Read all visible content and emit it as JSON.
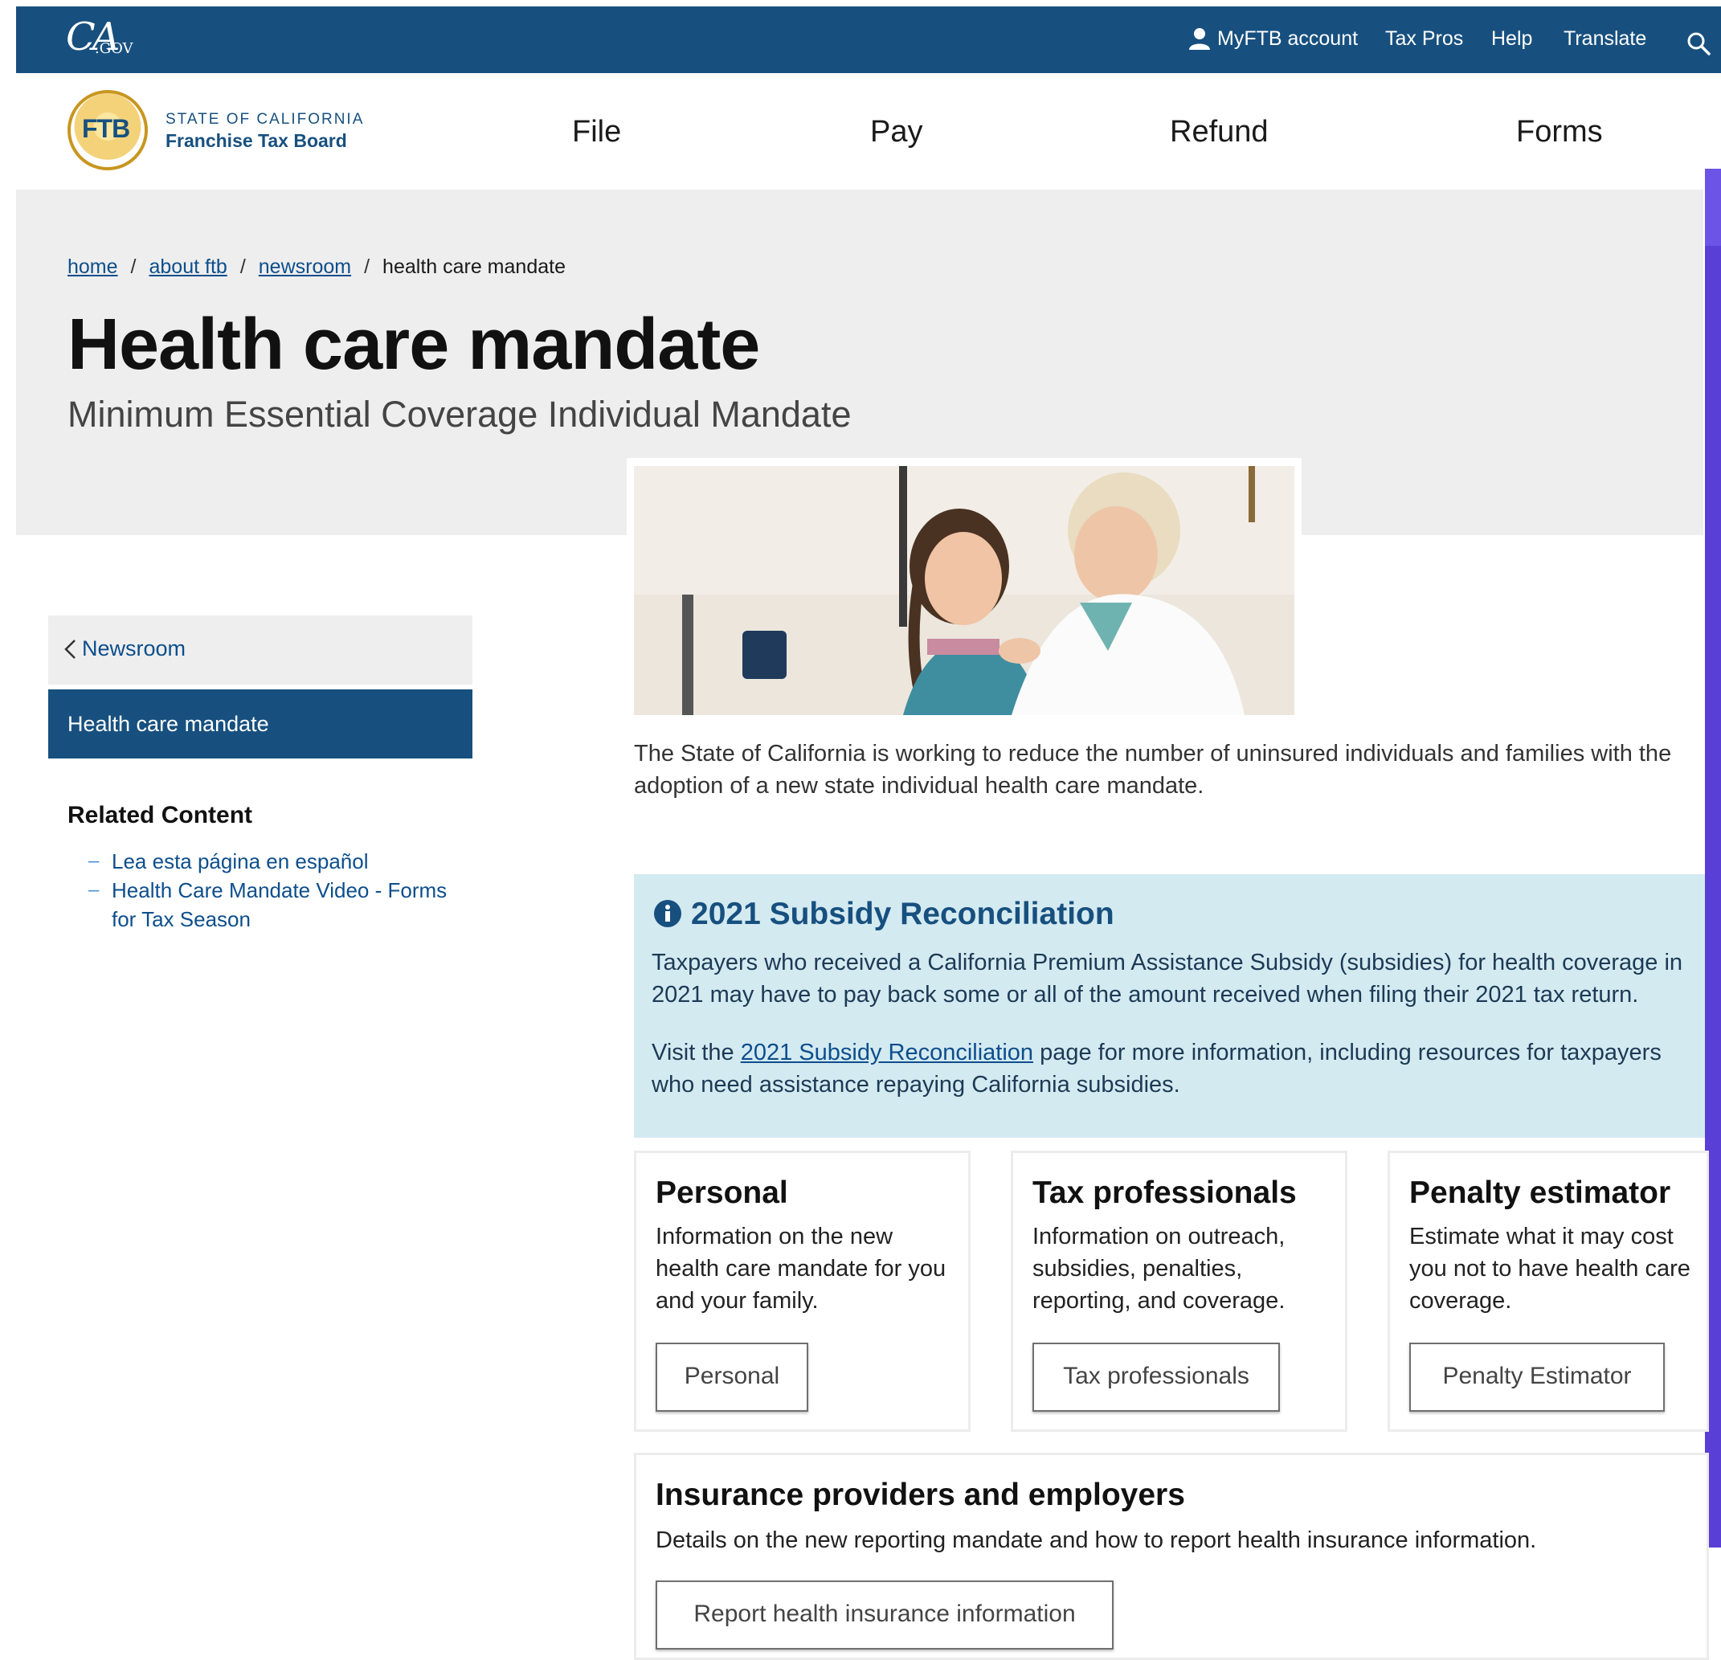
{
  "topbar": {
    "myftb_label": "MyFTB account",
    "taxpros_label": "Tax Pros",
    "help_label": "Help",
    "translate_label": "Translate",
    "brand_color": "#17507f"
  },
  "header": {
    "logo_text": "FTB",
    "state_text": "STATE OF CALIFORNIA",
    "agency_text": "Franchise Tax Board",
    "nav": [
      "File",
      "Pay",
      "Refund",
      "Forms"
    ]
  },
  "breadcrumb": {
    "home": "home",
    "about": "about ftb",
    "newsroom": "newsroom",
    "current": "health care mandate"
  },
  "page": {
    "title": "Health care mandate",
    "subtitle": "Minimum Essential Coverage Individual Mandate",
    "intro": "The State of California is working to reduce the number of uninsured individuals and families with the adoption of a new state individual health care mandate."
  },
  "sidebar": {
    "back_label": "Newsroom",
    "active_label": "Health care mandate",
    "related_title": "Related Content",
    "related": [
      "Lea esta página en español",
      "Health Care Mandate Video - Forms for Tax Season"
    ]
  },
  "alert": {
    "title": "2021 Subsidy Reconciliation",
    "p1": "Taxpayers who received a California Premium Assistance Subsidy (subsidies) for health coverage in 2021 may have to pay back some or all of the amount received when filing their 2021 tax return.",
    "p2_prefix": "Visit the ",
    "p2_link": "2021 Subsidy Reconciliation",
    "p2_suffix": " page for more information, including resources for taxpayers who need assistance repaying California subsidies.",
    "bg_color": "#d4eaf1"
  },
  "cards": [
    {
      "title": "Personal",
      "text": "Information on the new health care mandate for you and your family.",
      "button": "Personal"
    },
    {
      "title": "Tax professionals",
      "text": "Information on outreach, subsidies, penalties, reporting, and coverage.",
      "button": "Tax professionals"
    },
    {
      "title": "Penalty estimator",
      "text": "Estimate what it may cost you not to have health care coverage.",
      "button": "Penalty Estimator"
    }
  ],
  "insurance": {
    "title": "Insurance providers and employers",
    "text": "Details on the new reporting mandate and how to report health insurance information.",
    "button": "Report health insurance information"
  }
}
